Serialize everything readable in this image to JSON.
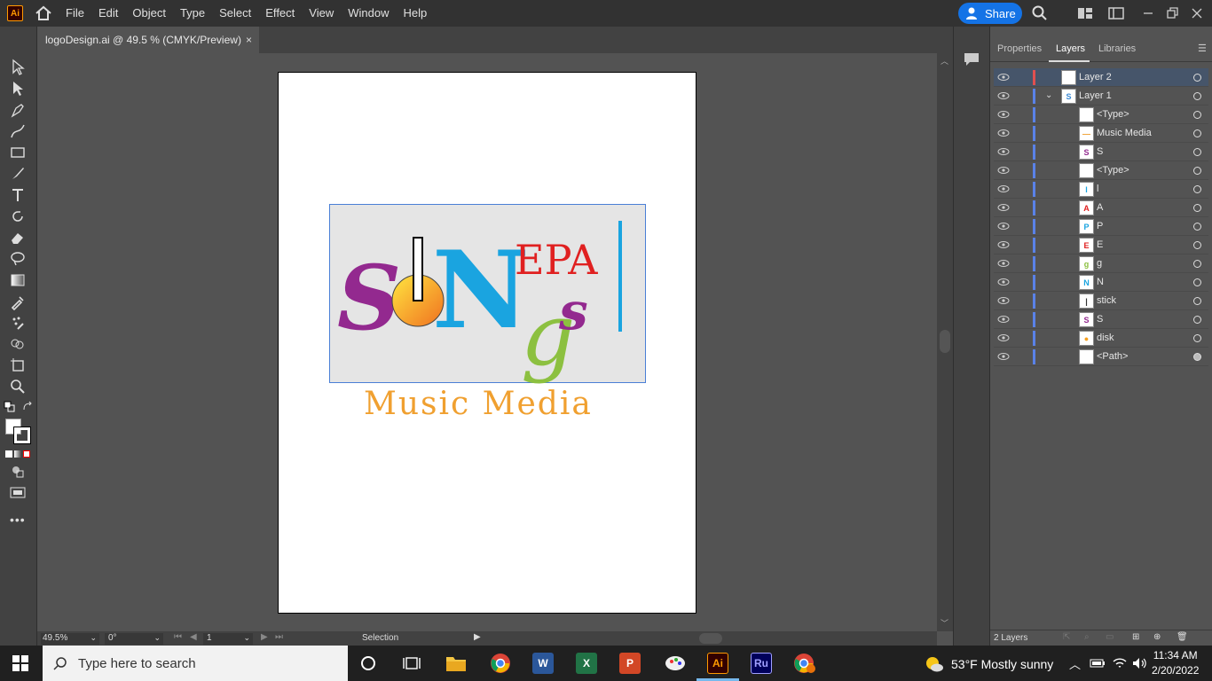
{
  "app": {
    "logo_text": "Ai"
  },
  "menu": [
    "File",
    "Edit",
    "Object",
    "Type",
    "Select",
    "Effect",
    "View",
    "Window",
    "Help"
  ],
  "share": {
    "label": "Share"
  },
  "document_tab": {
    "title": "logoDesign.ai @ 49.5 % (CMYK/Preview)",
    "close": "×"
  },
  "artwork": {
    "logo_letters": {
      "s1": "S",
      "n": "N",
      "epa": "EPA",
      "g": "g",
      "s2": "s"
    },
    "tagline": "Music Media"
  },
  "status": {
    "zoom": "49.5%",
    "rotation": "0°",
    "artboard": "1",
    "tool": "Selection"
  },
  "panel": {
    "tabs": [
      "Properties",
      "Layers",
      "Libraries"
    ],
    "active_tab": "Layers",
    "layers": [
      {
        "name": "Layer 2",
        "level": 0,
        "selected": true,
        "bar": "#e05050",
        "thumb": "",
        "thumb_color": "#ffffff",
        "filled": false
      },
      {
        "name": "Layer 1",
        "level": 0,
        "expanded": true,
        "bar": "#5a82e8",
        "thumb": "S",
        "thumb_color": "#3a8ad6",
        "filled": false
      },
      {
        "name": "<Type>",
        "level": 1,
        "bar": "#5a82e8",
        "thumb": "",
        "thumb_color": "#ffffff",
        "filled": false
      },
      {
        "name": "Music Media",
        "level": 1,
        "bar": "#5a82e8",
        "thumb": "—",
        "thumb_color": "#f0a030",
        "filled": false
      },
      {
        "name": "S",
        "level": 1,
        "bar": "#5a82e8",
        "thumb": "S",
        "thumb_color": "#93298f",
        "filled": false
      },
      {
        "name": "<Type>",
        "level": 1,
        "bar": "#5a82e8",
        "thumb": "",
        "thumb_color": "#ffffff",
        "filled": false
      },
      {
        "name": "l",
        "level": 1,
        "bar": "#5a82e8",
        "thumb": "l",
        "thumb_color": "#1aa4e0",
        "filled": false
      },
      {
        "name": "A",
        "level": 1,
        "bar": "#5a82e8",
        "thumb": "A",
        "thumb_color": "#e02020",
        "filled": false
      },
      {
        "name": "P",
        "level": 1,
        "bar": "#5a82e8",
        "thumb": "P",
        "thumb_color": "#1aa4e0",
        "filled": false
      },
      {
        "name": "E",
        "level": 1,
        "bar": "#5a82e8",
        "thumb": "E",
        "thumb_color": "#e02020",
        "filled": false
      },
      {
        "name": "g",
        "level": 1,
        "bar": "#5a82e8",
        "thumb": "g",
        "thumb_color": "#8cc040",
        "filled": false
      },
      {
        "name": "N",
        "level": 1,
        "bar": "#5a82e8",
        "thumb": "N",
        "thumb_color": "#1aa4e0",
        "filled": false
      },
      {
        "name": "stick",
        "level": 1,
        "bar": "#5a82e8",
        "thumb": "|",
        "thumb_color": "#333333",
        "filled": false
      },
      {
        "name": "S",
        "level": 1,
        "bar": "#5a82e8",
        "thumb": "S",
        "thumb_color": "#93298f",
        "filled": false
      },
      {
        "name": "disk",
        "level": 1,
        "bar": "#5a82e8",
        "thumb": "●",
        "thumb_color": "#f5a020",
        "filled": false
      },
      {
        "name": "<Path>",
        "level": 1,
        "bar": "#5a82e8",
        "thumb": "",
        "thumb_color": "#e5e5e5",
        "filled": true
      }
    ],
    "footer": "2 Layers"
  },
  "taskbar": {
    "search_placeholder": "Type here to search",
    "weather": "53°F  Mostly sunny",
    "time": "11:34 AM",
    "date": "2/20/2022",
    "apps": [
      {
        "name": "word",
        "label": "W",
        "color": "#2b579a"
      },
      {
        "name": "excel",
        "label": "X",
        "color": "#217346"
      },
      {
        "name": "powerpoint",
        "label": "P",
        "color": "#d24726"
      },
      {
        "name": "illustrator",
        "label": "Ai",
        "color": "#330000",
        "fg": "#ff9a00"
      },
      {
        "name": "rush",
        "label": "Ru",
        "color": "#00005b",
        "fg": "#a0a0ff"
      }
    ]
  },
  "colors": {
    "accent": "#1473e6",
    "purple": "#93298f",
    "cyan": "#1aa4e0",
    "red": "#e02020",
    "green": "#8cc040",
    "orange": "#f0a030"
  }
}
